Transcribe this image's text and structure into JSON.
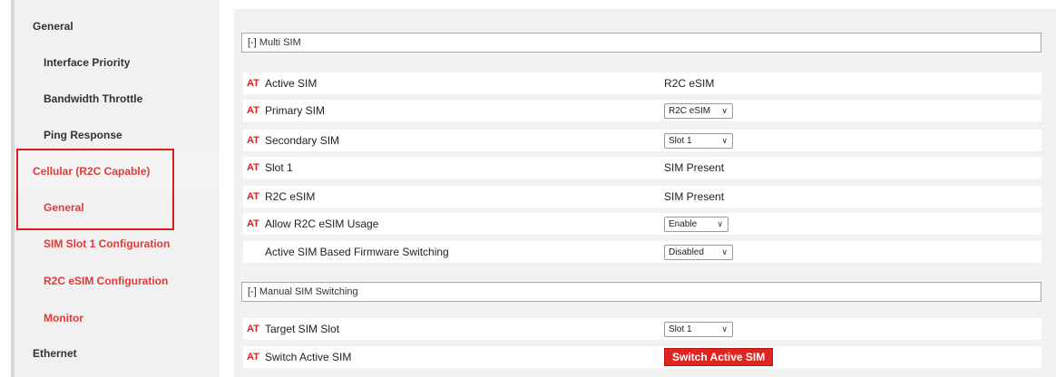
{
  "sidebar": {
    "items": [
      {
        "label": "General"
      },
      {
        "label": "Interface Priority"
      },
      {
        "label": "Bandwidth Throttle"
      },
      {
        "label": "Ping Response"
      },
      {
        "label": "Cellular (R2C Capable)"
      },
      {
        "label": "General"
      },
      {
        "label": "SIM Slot 1 Configuration"
      },
      {
        "label": "R2C eSIM Configuration"
      },
      {
        "label": "Monitor"
      },
      {
        "label": "Ethernet"
      }
    ]
  },
  "multi_sim": {
    "header": "[-] Multi SIM",
    "at_badge": "AT",
    "rows": [
      {
        "label": "Active SIM",
        "value": "R2C eSIM"
      },
      {
        "label": "Primary SIM",
        "value": "R2C eSIM"
      },
      {
        "label": "Secondary SIM",
        "value": "Slot 1"
      },
      {
        "label": "Slot 1",
        "value": "SIM Present"
      },
      {
        "label": "R2C eSIM",
        "value": "SIM Present"
      },
      {
        "label": "Allow R2C eSIM Usage",
        "value": "Enable"
      },
      {
        "label": "Active SIM Based Firmware Switching",
        "value": "Disabled"
      }
    ]
  },
  "manual_switching": {
    "header": "[-] Manual SIM Switching",
    "rows": [
      {
        "label": "Target SIM Slot",
        "value": "Slot 1"
      },
      {
        "label": "Switch Active SIM",
        "button_label": "Switch Active SIM"
      }
    ]
  },
  "colors": {
    "accent_red": "#e53935",
    "sidebar_bg": "#f1f1f1",
    "main_bg": "#f2f2f2",
    "highlight_border": "#d91e1e"
  },
  "icons": {
    "dropdown": "chevron-down-icon"
  }
}
